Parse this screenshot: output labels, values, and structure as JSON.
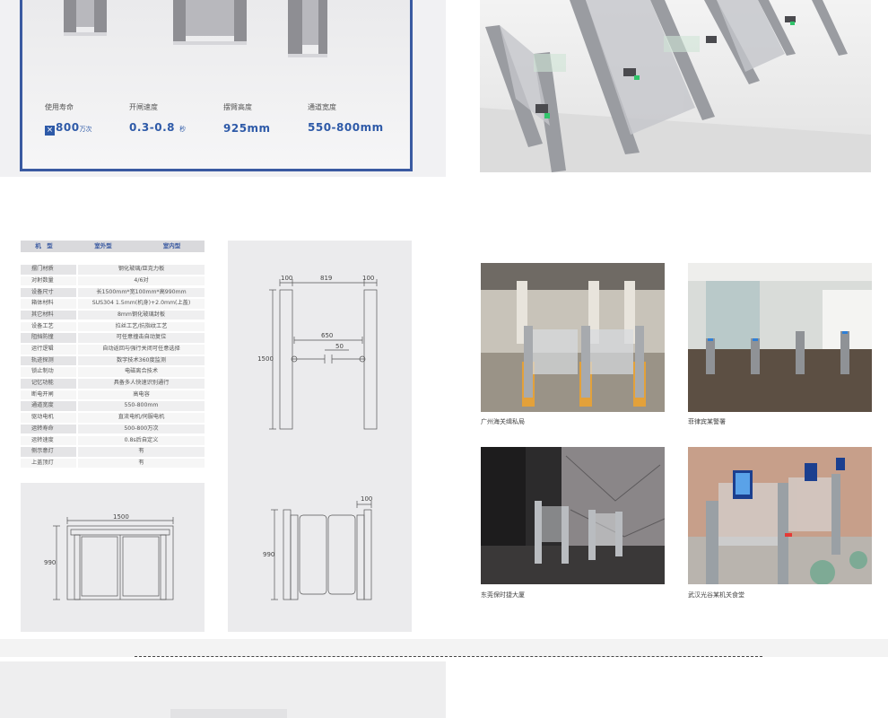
{
  "specs": [
    {
      "label": "使用寿命",
      "prefix": "×",
      "value": "800",
      "unit": "万次"
    },
    {
      "label": "开闸速度",
      "value": "0.3-0.8",
      "unit": "秒"
    },
    {
      "label": "摆臂高度",
      "value": "925mm",
      "unit": ""
    },
    {
      "label": "通道宽度",
      "value": "550-800mm",
      "unit": ""
    }
  ],
  "table": {
    "headers": [
      "机　型",
      "室外型",
      "室内型"
    ],
    "rows": [
      [
        "摆门材质",
        "钢化玻璃/亚克力板"
      ],
      [
        "对射数量",
        "4/6对"
      ],
      [
        "设备尺寸",
        "长1500mm*宽100mm*高990mm"
      ],
      [
        "箱体材料",
        "SUS304 1.5mm(机身)+2.0mm(上盖)"
      ],
      [
        "其它材料",
        "8mm钢化玻璃封板"
      ],
      [
        "设备工艺",
        "拉丝工艺/抗指纹工艺"
      ],
      [
        "阻挡防撞",
        "可任意撞击自动复位"
      ],
      [
        "运行逻辑",
        "自动返回与强行关闭可任意选择"
      ],
      [
        "轨迹探测",
        "数字技术360度监测"
      ],
      [
        "锁止制动",
        "电磁离合技术"
      ],
      [
        "记忆功能",
        "具备多人快速识别通行"
      ],
      [
        "断电开闸",
        "高电容"
      ],
      [
        "通道宽度",
        "550-800mm"
      ],
      [
        "驱动电机",
        "直流电机/伺服电机"
      ],
      [
        "运转寿命",
        "500-800万次"
      ],
      [
        "运转速度",
        "0.8s后自定义"
      ],
      [
        "侧示意灯",
        "有"
      ],
      [
        "上盖顶灯",
        "有"
      ]
    ]
  },
  "drawings": {
    "front": {
      "total": "1500",
      "height": "990"
    },
    "top": {
      "post_a": "100",
      "gap": "819",
      "post_b": "100",
      "length": "1500",
      "arm": "650",
      "small": "50"
    },
    "side": {
      "width": "100",
      "height": "990"
    }
  },
  "photos": [
    {
      "caption": "广州海关缉私局"
    },
    {
      "caption": "菲律宾某警署"
    },
    {
      "caption": "东莞保时捷大厦"
    },
    {
      "caption": "武汉光谷某机关食堂"
    }
  ]
}
